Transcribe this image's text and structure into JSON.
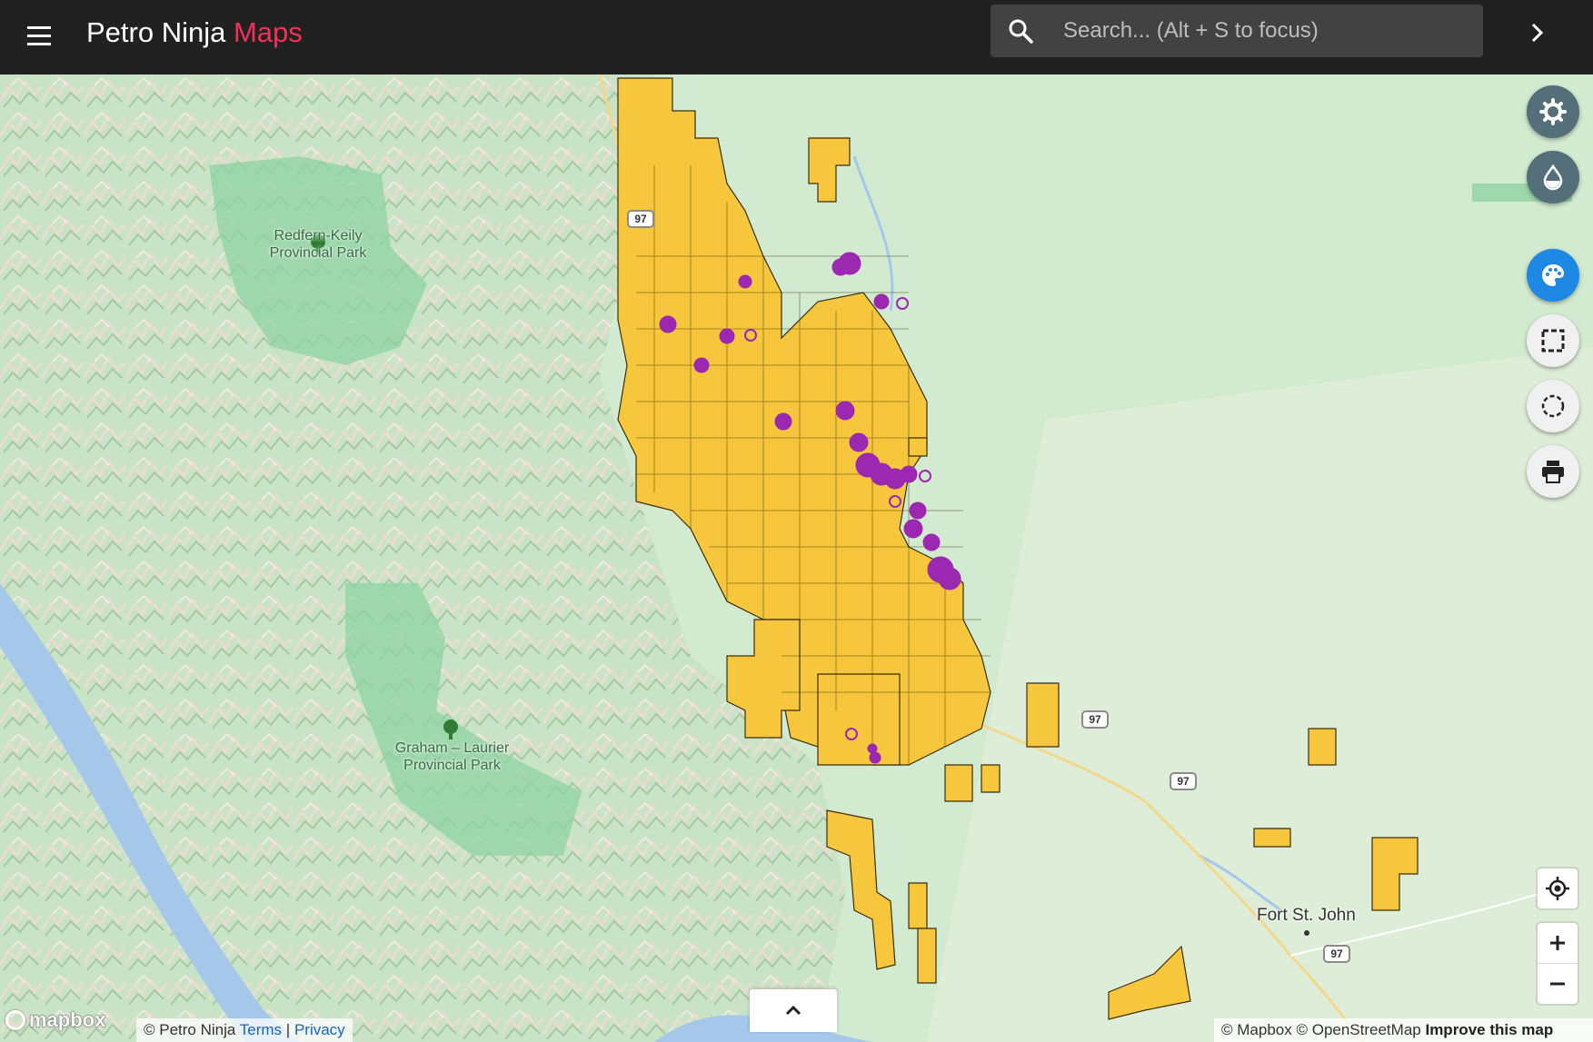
{
  "header": {
    "app_name": "Petro Ninja",
    "app_name_accent": "Maps",
    "search_placeholder": "Search... (Alt + S to focus)",
    "menu_icon": "hamburger-menu-icon",
    "search_icon": "magnifier-icon",
    "expand_icon": "chevron-right-icon"
  },
  "map": {
    "parks": [
      {
        "name": "Redfern-Keily\nProvincial Park"
      },
      {
        "name": "Graham – Laurier\nProvincial Park"
      }
    ],
    "cities": [
      {
        "name": "Fort St. John"
      }
    ],
    "highway_shields": [
      "97",
      "97",
      "97",
      "97"
    ]
  },
  "right_controls": [
    {
      "name": "settings",
      "icon": "gear-icon",
      "style": "dark"
    },
    {
      "name": "basemap",
      "icon": "water-drop-icon",
      "style": "dark"
    },
    {
      "name": "style",
      "icon": "palette-icon",
      "style": "blue"
    },
    {
      "name": "select-rectangle",
      "icon": "rectangle-select-icon",
      "style": "light"
    },
    {
      "name": "select-circle",
      "icon": "circle-select-icon",
      "style": "light"
    },
    {
      "name": "print",
      "icon": "printer-icon",
      "style": "light"
    }
  ],
  "map_controls": {
    "locate_icon": "crosshair-icon",
    "zoom_in_icon": "plus-icon",
    "zoom_out_icon": "minus-icon",
    "collapse_icon": "chevron-up-icon"
  },
  "attribution": {
    "mapbox_logo": "mapbox",
    "copyright_left": "© Petro Ninja",
    "terms": "Terms",
    "separator": "|",
    "privacy": "Privacy",
    "mapbox_credit": "© Mapbox",
    "osm_credit": "© OpenStreetMap",
    "improve": "Improve this map"
  },
  "colors": {
    "header_bg": "#212121",
    "accent": "#f0325a",
    "lease_fill": "#f6c63c",
    "lease_stroke": "#3a2f10",
    "well_marker": "#9c27b0",
    "water": "#a5c8ea",
    "park": "#8ed3a3",
    "fab_dark": "#546e7a",
    "fab_blue": "#1e88e5"
  }
}
